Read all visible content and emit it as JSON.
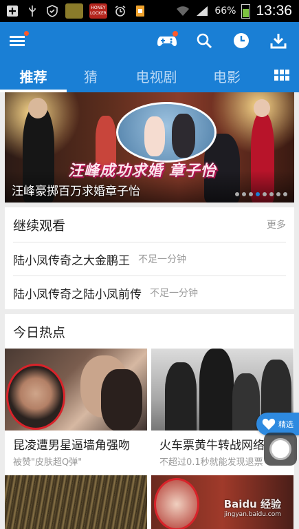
{
  "status_bar": {
    "battery": "66%",
    "time": "13:36",
    "app_badge": "HONEY LOCKER"
  },
  "header": {
    "tabs": [
      {
        "label": "推荐",
        "active": true
      },
      {
        "label": "猜",
        "active": false
      },
      {
        "label": "电视剧",
        "active": false
      },
      {
        "label": "电影",
        "active": false
      }
    ]
  },
  "banner": {
    "overlay_text": "汪峰成功求婚 章子怡",
    "caption": "汪峰豪掷百万求婚章子怡",
    "dots": 8,
    "active_dot": 3
  },
  "continue_watching": {
    "title": "继续观看",
    "more": "更多",
    "items": [
      {
        "title": "陆小凤传奇之大金鹏王",
        "time": "不足一分钟"
      },
      {
        "title": "陆小凤传奇之陆小凤前传",
        "time": "不足一分钟"
      }
    ]
  },
  "hot_today": {
    "title": "今日热点",
    "items": [
      {
        "title": "昆凌遭男星逼墙角强吻",
        "subtitle": "被赞\"皮肤超Q弹\""
      },
      {
        "title": "火车票黄牛转战网络",
        "subtitle": "不超过0.1秒就能发现退票"
      }
    ]
  },
  "float_tab": {
    "label": "精选"
  },
  "watermark": {
    "brand": "Baidu 经验",
    "url": "jingyan.baidu.com"
  },
  "colors": {
    "primary": "#1a7fd5",
    "tab_inactive": "#b9d8f5"
  }
}
